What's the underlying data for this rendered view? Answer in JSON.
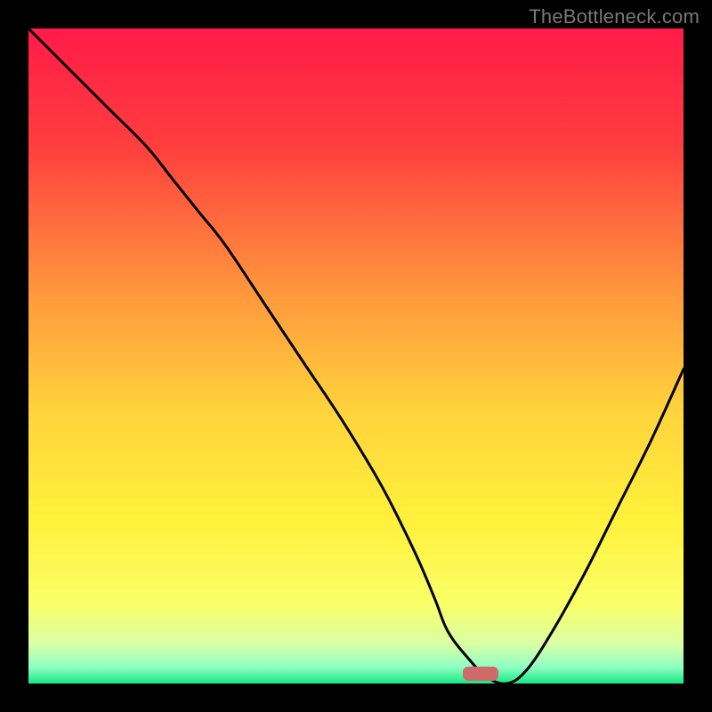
{
  "watermark": {
    "text": "TheBottleneck.com"
  },
  "chart_data": {
    "type": "line",
    "title": "",
    "xlabel": "",
    "ylabel": "",
    "xlim": [
      0,
      100
    ],
    "ylim": [
      0,
      100
    ],
    "grid": false,
    "legend": false,
    "background_gradient": {
      "stops": [
        {
          "pos": 0.0,
          "color": "#ff1b48"
        },
        {
          "pos": 0.18,
          "color": "#ff3e3e"
        },
        {
          "pos": 0.4,
          "color": "#ff963d"
        },
        {
          "pos": 0.58,
          "color": "#ffd23c"
        },
        {
          "pos": 0.75,
          "color": "#fff13b"
        },
        {
          "pos": 0.88,
          "color": "#faff69"
        },
        {
          "pos": 0.94,
          "color": "#d9ffa5"
        },
        {
          "pos": 0.975,
          "color": "#8effc4"
        },
        {
          "pos": 1.0,
          "color": "#17e884"
        }
      ]
    },
    "series": [
      {
        "name": "bottleneck-curve",
        "color": "#000000",
        "x": [
          0,
          6,
          12,
          18,
          22,
          26,
          30,
          36,
          42,
          48,
          54,
          59,
          62,
          64,
          67,
          70,
          73,
          76,
          80,
          85,
          90,
          95,
          100
        ],
        "y": [
          100,
          94,
          88,
          82,
          77,
          72,
          67,
          58,
          49,
          40,
          30,
          20,
          13,
          8,
          4,
          1,
          0,
          2,
          8,
          17,
          27,
          37,
          48
        ]
      }
    ],
    "marker": {
      "name": "optimal-range",
      "color": "#d06a6a",
      "x_center": 69,
      "y_center": 1.5,
      "width_pct": 5.5,
      "height_pct": 2.2
    }
  }
}
